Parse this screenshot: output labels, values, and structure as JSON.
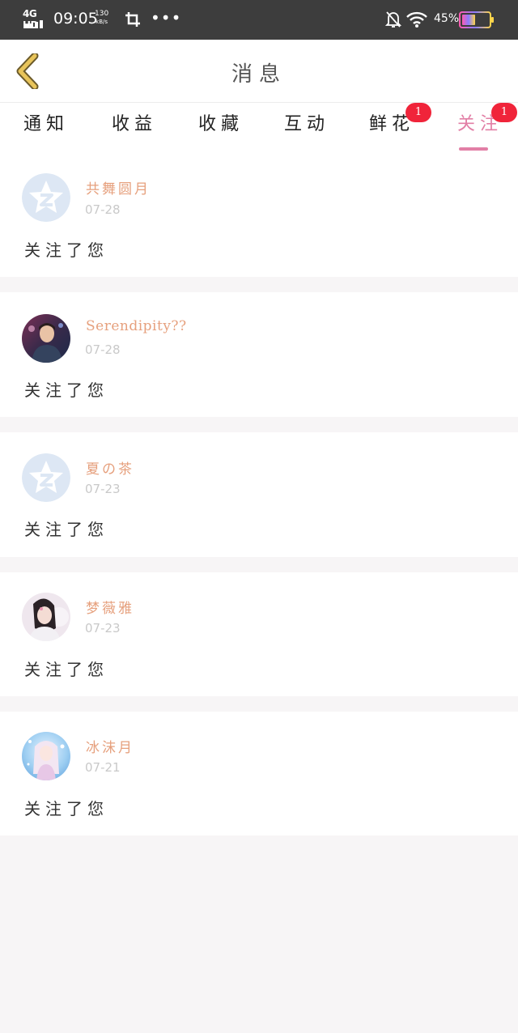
{
  "status_bar": {
    "network": "4G HD",
    "time": "09:05",
    "speed_value": "130",
    "speed_unit": "kB/s",
    "more": "•••",
    "battery_percent": "45%"
  },
  "header": {
    "title": "消息",
    "back_icon": "chevron-left-icon",
    "back_color": "#e8c45a"
  },
  "tabs": [
    {
      "label": "通知",
      "badge": null,
      "active": false
    },
    {
      "label": "收益",
      "badge": null,
      "active": false
    },
    {
      "label": "收藏",
      "badge": null,
      "active": false
    },
    {
      "label": "互动",
      "badge": null,
      "active": false
    },
    {
      "label": "鲜花",
      "badge": "1",
      "active": false
    },
    {
      "label": "关注",
      "badge": "1",
      "active": true
    }
  ],
  "colors": {
    "accent": "#e27fa6",
    "username": "#e6a07d",
    "badge": "#f0243a"
  },
  "notifications": [
    {
      "name": "共舞圆月",
      "date": "07-28",
      "message": "关注了您",
      "avatar": "default-avatar"
    },
    {
      "name": "Serendipity??",
      "date": "07-28",
      "message": "关注了您",
      "avatar": "photo-avatar-man"
    },
    {
      "name": "夏の茶",
      "date": "07-23",
      "message": "关注了您",
      "avatar": "default-avatar"
    },
    {
      "name": "梦薇雅",
      "date": "07-23",
      "message": "关注了您",
      "avatar": "photo-avatar-girl"
    },
    {
      "name": "冰沫月",
      "date": "07-21",
      "message": "关注了您",
      "avatar": "photo-avatar-anime"
    }
  ]
}
